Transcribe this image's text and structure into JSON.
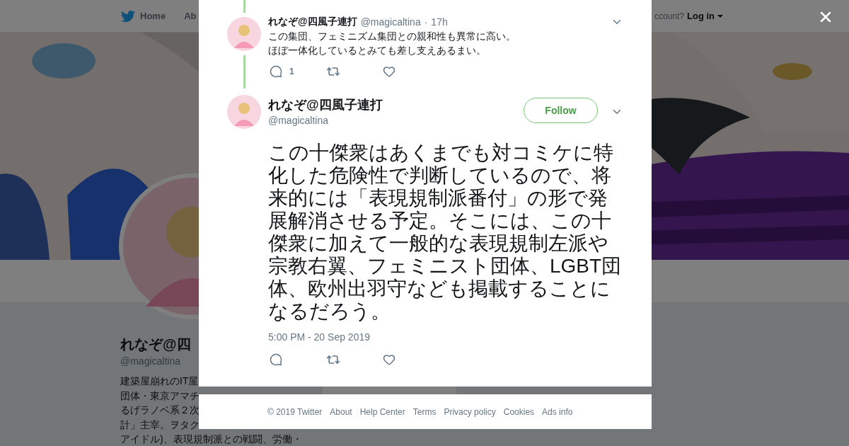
{
  "background": {
    "nav": {
      "items": [
        "Home",
        "Ab"
      ],
      "login_prompt": "ccount?",
      "login": "Log in"
    },
    "profile": {
      "name": "れなぞ@四",
      "handle": "@magicaltina",
      "bio": [
        "建築屋崩れのIT屋",
        "団体・東京アマチ",
        "るげラノベ系２次",
        "計」主宰。ヲタク",
        "アイドル)、表現規制派との戦闘、労働・"
      ]
    }
  },
  "thread": {
    "parent": {
      "name": "れなぞ@四風子連打",
      "handle": "@magicaltina",
      "separator": "·",
      "time": "17h",
      "text": [
        "この集団、フェミニズム集団との親和性も異常に高い。",
        "ほぼ一体化しているとみても差し支えあるまい。"
      ],
      "reply_count": "1"
    },
    "tweet": {
      "name": "れなぞ@四風子連打",
      "handle": "@magicaltina",
      "follow": "Follow",
      "text": "この十傑衆はあくまでも対コミケに特化した危険性で判断しているので、将来的には「表現規制派番付」の形で発展解消させる予定。そこには、この十傑衆に加えて一般的な表現規制左派や宗教右翼、フェミニスト団体、LGBT団体、欧州出羽守なども掲載することになるだろう。",
      "timestamp": "5:00 PM - 20 Sep 2019"
    }
  },
  "footer": [
    "© 2019 Twitter",
    "About",
    "Help Center",
    "Terms",
    "Privacy policy",
    "Cookies",
    "Ads info"
  ]
}
